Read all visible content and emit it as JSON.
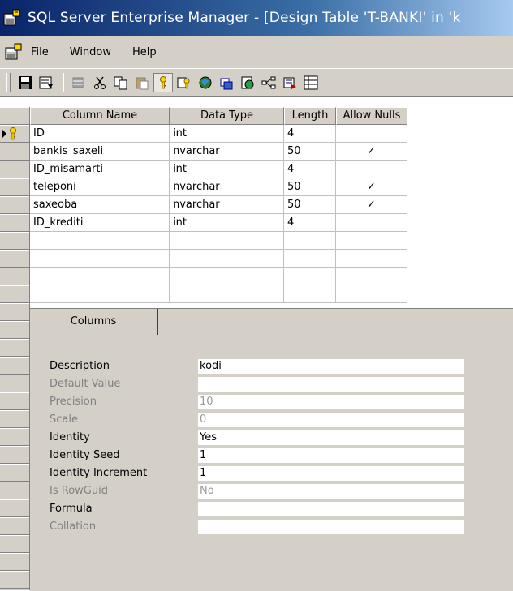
{
  "window": {
    "title": "SQL Server Enterprise Manager - [Design Table 'T-BANKI' in 'k"
  },
  "menu": {
    "items": [
      {
        "label": "File"
      },
      {
        "label": "Window"
      },
      {
        "label": "Help"
      }
    ]
  },
  "toolbar": {
    "buttons": [
      {
        "icon": "save-icon"
      },
      {
        "icon": "properties-icon"
      },
      {
        "icon": "insert-column-icon"
      },
      {
        "icon": "cut-icon"
      },
      {
        "icon": "copy-icon"
      },
      {
        "icon": "paste-icon"
      },
      {
        "icon": "primary-key-icon",
        "pressed": true
      },
      {
        "icon": "manage-indexes-icon"
      },
      {
        "icon": "manage-relationships-icon"
      },
      {
        "icon": "manage-constraints-icon"
      },
      {
        "icon": "manage-triggers-icon"
      },
      {
        "icon": "show-dependencies-icon"
      },
      {
        "icon": "generate-script-icon"
      },
      {
        "icon": "grid-view-icon"
      }
    ]
  },
  "grid": {
    "headers": [
      "Column Name",
      "Data Type",
      "Length",
      "Allow Nulls"
    ],
    "rows": [
      {
        "name": "ID",
        "type": "int",
        "length": "4",
        "nulls": "",
        "key": true
      },
      {
        "name": "bankis_saxeli",
        "type": "nvarchar",
        "length": "50",
        "nulls": "✓"
      },
      {
        "name": "ID_misamarti",
        "type": "int",
        "length": "4",
        "nulls": ""
      },
      {
        "name": "teleponi",
        "type": "nvarchar",
        "length": "50",
        "nulls": "✓"
      },
      {
        "name": "saxeoba",
        "type": "nvarchar",
        "length": "50",
        "nulls": "✓"
      },
      {
        "name": "ID_krediti",
        "type": "int",
        "length": "4",
        "nulls": ""
      }
    ]
  },
  "properties": {
    "tab_label": "Columns",
    "items": [
      {
        "label": "Description",
        "value": "kodi",
        "enabled": true
      },
      {
        "label": "Default Value",
        "value": "",
        "enabled": false
      },
      {
        "label": "Precision",
        "value": "10",
        "enabled": false
      },
      {
        "label": "Scale",
        "value": "0",
        "enabled": false
      },
      {
        "label": "Identity",
        "value": "Yes",
        "enabled": true
      },
      {
        "label": "Identity Seed",
        "value": "1",
        "enabled": true
      },
      {
        "label": "Identity Increment",
        "value": "1",
        "enabled": true
      },
      {
        "label": "Is RowGuid",
        "value": "No",
        "enabled": false
      },
      {
        "label": "Formula",
        "value": "",
        "enabled": true
      },
      {
        "label": "Collation",
        "value": "",
        "enabled": false
      }
    ]
  },
  "colors": {
    "titlebar_start": "#0a246a",
    "titlebar_end": "#a6caf0",
    "chrome": "#d4d0c8"
  }
}
